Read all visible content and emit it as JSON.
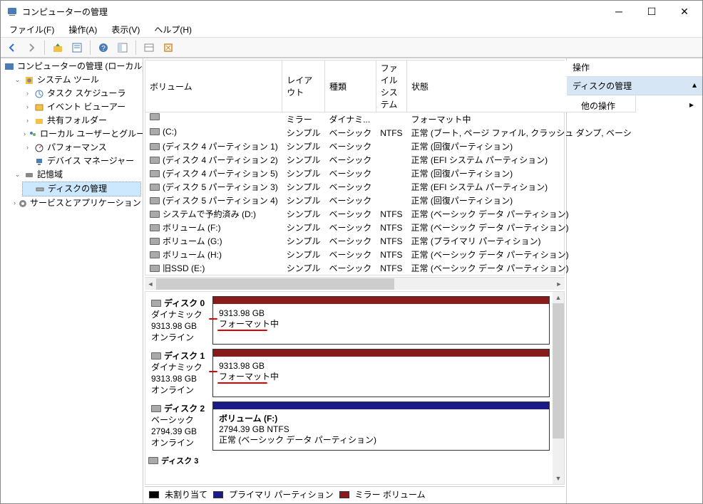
{
  "window": {
    "title": "コンピューターの管理"
  },
  "menubar": [
    "ファイル(F)",
    "操作(A)",
    "表示(V)",
    "ヘルプ(H)"
  ],
  "tree": {
    "root": "コンピューターの管理 (ローカル)",
    "systools": {
      "label": "システム ツール",
      "items": [
        "タスク スケジューラ",
        "イベント ビューアー",
        "共有フォルダー",
        "ローカル ユーザーとグループ",
        "パフォーマンス",
        "デバイス マネージャー"
      ]
    },
    "storage": {
      "label": "記憶域",
      "disk": "ディスクの管理"
    },
    "services": "サービスとアプリケーション"
  },
  "vol_table": {
    "headers": [
      "ボリューム",
      "レイアウト",
      "種類",
      "ファイル システム",
      "状態"
    ],
    "rows": [
      {
        "name": "",
        "layout": "ミラー",
        "type": "ダイナミ...",
        "fs": "",
        "status": "フォーマット中"
      },
      {
        "name": "(C:)",
        "layout": "シンプル",
        "type": "ベーシック",
        "fs": "NTFS",
        "status": "正常 (ブート, ページ ファイル, クラッシュ ダンプ, ベーシ"
      },
      {
        "name": "(ディスク 4 パーティション 1)",
        "layout": "シンプル",
        "type": "ベーシック",
        "fs": "",
        "status": "正常 (回復パーティション)"
      },
      {
        "name": "(ディスク 4 パーティション 2)",
        "layout": "シンプル",
        "type": "ベーシック",
        "fs": "",
        "status": "正常 (EFI システム パーティション)"
      },
      {
        "name": "(ディスク 4 パーティション 5)",
        "layout": "シンプル",
        "type": "ベーシック",
        "fs": "",
        "status": "正常 (回復パーティション)"
      },
      {
        "name": "(ディスク 5 パーティション 3)",
        "layout": "シンプル",
        "type": "ベーシック",
        "fs": "",
        "status": "正常 (EFI システム パーティション)"
      },
      {
        "name": "(ディスク 5 パーティション 4)",
        "layout": "シンプル",
        "type": "ベーシック",
        "fs": "",
        "status": "正常 (回復パーティション)"
      },
      {
        "name": "システムで予約済み (D:)",
        "layout": "シンプル",
        "type": "ベーシック",
        "fs": "NTFS",
        "status": "正常 (ベーシック データ パーティション)"
      },
      {
        "name": "ボリューム (F:)",
        "layout": "シンプル",
        "type": "ベーシック",
        "fs": "NTFS",
        "status": "正常 (ベーシック データ パーティション)"
      },
      {
        "name": "ボリューム (G:)",
        "layout": "シンプル",
        "type": "ベーシック",
        "fs": "NTFS",
        "status": "正常 (プライマリ パーティション)"
      },
      {
        "name": "ボリューム (H:)",
        "layout": "シンプル",
        "type": "ベーシック",
        "fs": "NTFS",
        "status": "正常 (ベーシック データ パーティション)"
      },
      {
        "name": "旧SSD (E:)",
        "layout": "シンプル",
        "type": "ベーシック",
        "fs": "NTFS",
        "status": "正常 (ベーシック データ パーティション)"
      }
    ]
  },
  "disks": [
    {
      "name": "ディスク 0",
      "type": "ダイナミック",
      "size": "9313.98 GB",
      "state": "オンライン",
      "part_stripe": "mirror",
      "part_text1": "9313.98 GB",
      "part_text2": "フォーマット中",
      "underline": true
    },
    {
      "name": "ディスク 1",
      "type": "ダイナミック",
      "size": "9313.98 GB",
      "state": "オンライン",
      "part_stripe": "mirror",
      "part_text1": "9313.98 GB",
      "part_text2": "フォーマット中",
      "underline": true
    },
    {
      "name": "ディスク 2",
      "type": "ベーシック",
      "size": "2794.39 GB",
      "state": "オンライン",
      "part_stripe": "primary",
      "part_title": "ボリューム  (F:)",
      "part_text1": "2794.39 GB NTFS",
      "part_text2": "正常 (ベーシック データ パーティション)",
      "underline": false
    }
  ],
  "disk_partial": "ディスク 3",
  "legend": {
    "unalloc": "未割り当て",
    "primary": "プライマリ パーティション",
    "mirror": "ミラー ボリューム"
  },
  "actions": {
    "header": "操作",
    "section": "ディスクの管理",
    "more": "他の操作"
  }
}
